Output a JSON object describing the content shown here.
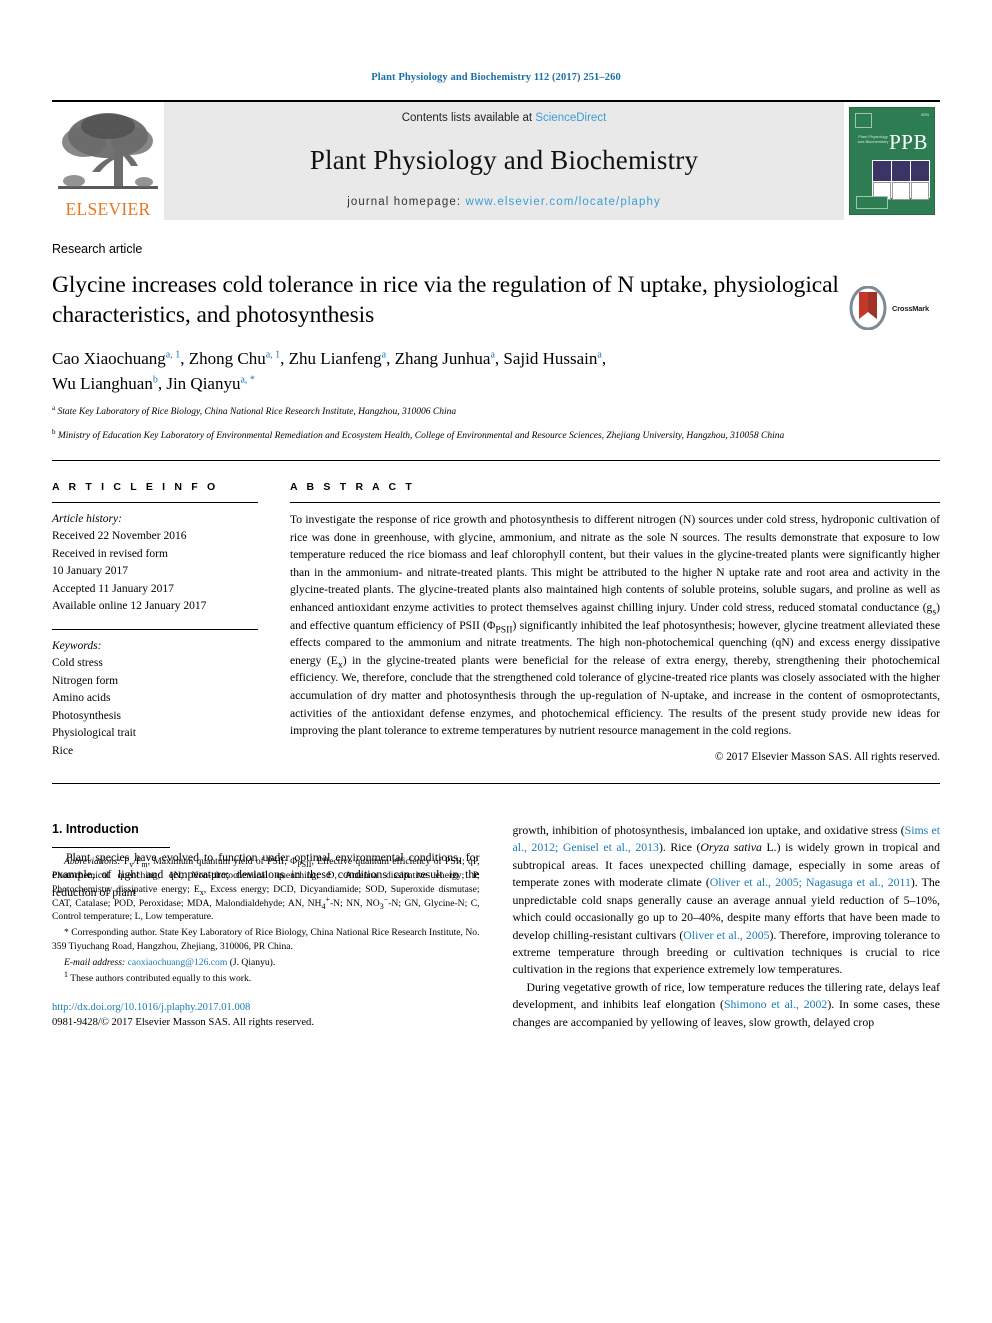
{
  "running_head": "Plant Physiology and Biochemistry 112 (2017) 251–260",
  "masthead": {
    "elsevier_wordmark": "ELSEVIER",
    "contents_prefix": "Contents lists available at ",
    "sciencedirect": "ScienceDirect",
    "journal_title": "Plant Physiology and Biochemistry",
    "homepage_prefix": "journal homepage: ",
    "homepage_url": "www.elsevier.com/locate/plaphy",
    "cover_acronym": "PPB",
    "cover_subtitle": "Plant Physiology and Biochemistry"
  },
  "article": {
    "type": "Research article",
    "title": "Glycine increases cold tolerance in rice via the regulation of N uptake, physiological characteristics, and photosynthesis",
    "crossmark_label": "CrossMark",
    "authors_line1_parts": [
      {
        "name": "Cao Xiaochuang",
        "sup": "a, 1"
      },
      {
        "name": "Zhong Chu",
        "sup": "a, 1"
      },
      {
        "name": "Zhu Lianfeng",
        "sup": "a"
      },
      {
        "name": "Zhang Junhua",
        "sup": "a"
      },
      {
        "name": "Sajid Hussain",
        "sup": "a"
      }
    ],
    "authors_line2_parts": [
      {
        "name": "Wu Lianghuan",
        "sup": "b"
      },
      {
        "name": "Jin Qianyu",
        "sup": "a, *"
      }
    ],
    "affiliations": [
      {
        "mark": "a",
        "text": "State Key Laboratory of Rice Biology, China National Rice Research Institute, Hangzhou, 310006 China"
      },
      {
        "mark": "b",
        "text": "Ministry of Education Key Laboratory of Environmental Remediation and Ecosystem Health, College of Environmental and Resource Sciences, Zhejiang University, Hangzhou, 310058 China"
      }
    ]
  },
  "article_info": {
    "heading": "A R T I C L E  I N F O",
    "history_label": "Article history:",
    "history": [
      "Received 22 November 2016",
      "Received in revised form",
      "10 January 2017",
      "Accepted 11 January 2017",
      "Available online 12 January 2017"
    ],
    "keywords_label": "Keywords:",
    "keywords": [
      "Cold stress",
      "Nitrogen form",
      "Amino acids",
      "Photosynthesis",
      "Physiological trait",
      "Rice"
    ]
  },
  "abstract": {
    "heading": "A B S T R A C T",
    "text_part1": "To investigate the response of rice growth and photosynthesis to different nitrogen (N) sources under cold stress, hydroponic cultivation of rice was done in greenhouse, with glycine, ammonium, and nitrate as the sole N sources. The results demonstrate that exposure to low temperature reduced the rice biomass and leaf chlorophyll content, but their values in the glycine-treated plants were significantly higher than in the ammonium- and nitrate-treated plants. This might be attributed to the higher N uptake rate and root area and activity in the glycine-treated plants. The glycine-treated plants also maintained high contents of soluble proteins, soluble sugars, and proline as well as enhanced antioxidant enzyme activities to protect themselves against chilling injury. Under cold stress, reduced stomatal conductance (g",
    "sub1": "s",
    "text_part2": ") and effective quantum efficiency of PSII (Φ",
    "sub2": "PSII",
    "text_part3": ") significantly inhibited the leaf photosynthesis; however, glycine treatment alleviated these effects compared to the ammonium and nitrate treatments. The high non-photochemical quenching (qN) and excess energy dissipative energy (E",
    "sub3": "x",
    "text_part4": ") in the glycine-treated plants were beneficial for the release of extra energy, thereby, strengthening their photochemical efficiency. We, therefore, conclude that the strengthened cold tolerance of glycine-treated rice plants was closely associated with the higher accumulation of dry matter and photosynthesis through the up-regulation of N-uptake, and increase in the content of osmoprotectants, activities of the antioxidant defense enzymes, and photochemical efficiency. The results of the present study provide new ideas for improving the plant tolerance to extreme temperatures by nutrient resource management in the cold regions.",
    "copyright": "© 2017 Elsevier Masson SAS. All rights reserved."
  },
  "body": {
    "section_number_title": "1.  Introduction",
    "left_para": "Plant species have evolved to function under optimal environmental conditions, for example, of light and temperature; deviations in these conditions can result in the reduction of plant",
    "right_p1_a": "growth, inhibition of photosynthesis, imbalanced ion uptake, and oxidative stress (",
    "right_p1_ref1": "Sims et al., 2012; Genisel et al., 2013",
    "right_p1_b": "). Rice (",
    "right_p1_italic1": "Oryza sativa",
    "right_p1_c": " L.) is widely grown in tropical and subtropical areas. It faces unexpected chilling damage, especially in some areas of temperate zones with moderate climate (",
    "right_p1_ref2": "Oliver et al., 2005; Nagasuga et al., 2011",
    "right_p1_d": "). The unpredictable cold snaps generally cause an average annual yield reduction of 5–10%, which could occasionally go up to 20–40%, despite many efforts that have been made to develop chilling-resistant cultivars (",
    "right_p1_ref3": "Oliver et al., 2005",
    "right_p1_e": "). Therefore, improving tolerance to extreme temperature through breeding or cultivation techniques is crucial to rice cultivation in the regions that experience extremely low temperatures.",
    "right_p2_a": "During vegetative growth of rice, low temperature reduces the tillering rate, delays leaf development, and inhibits leaf elongation (",
    "right_p2_ref1": "Shimono et al., 2002",
    "right_p2_b": "). In some cases, these changes are accompanied by yellowing of leaves, slow growth, delayed crop"
  },
  "footnotes": {
    "abbrev_label": "Abbreviations:",
    "abbrev_text": "Fᵥ/Fₘ, Maximum quantum yield of PSII; ΦPSII, Effective quantum efficiency of PSII; qP, Photochemical quenching; qN, Non-photochemical quenching; D, Antenna dissipative energy; P, Photochemistry dissipative energy; Ex, Excess energy; DCD, Dicyandiamide; SOD, Superoxide dismutase; CAT, Catalase; POD, Peroxidase; MDA, Malondialdehyde; AN, NH4+-N; NN, NO3--N; GN, Glycine-N; C, Control temperature; L, Low temperature.",
    "corresponding_marker": "*",
    "corresponding_text": "Corresponding author. State Key Laboratory of Rice Biology, China National Rice Research Institute, No. 359 Tiyuchang Road, Hangzhou, Zhejiang, 310006, PR China.",
    "email_label": "E-mail address:",
    "email": "caoxiaochuang@126.com",
    "email_suffix": "(J. Qianyu).",
    "equal_contrib_marker": "1",
    "equal_contrib_text": "These authors contributed equally to this work.",
    "doi": "http://dx.doi.org/10.1016/j.plaphy.2017.01.008",
    "issn_line": "0981-9428/© 2017 Elsevier Masson SAS. All rights reserved."
  },
  "colors": {
    "link_blue": "#1a7bb9",
    "sciencedirect_blue": "#3b9dd4",
    "elsevier_orange": "#E87722",
    "cover_green": "#2e7d52"
  }
}
